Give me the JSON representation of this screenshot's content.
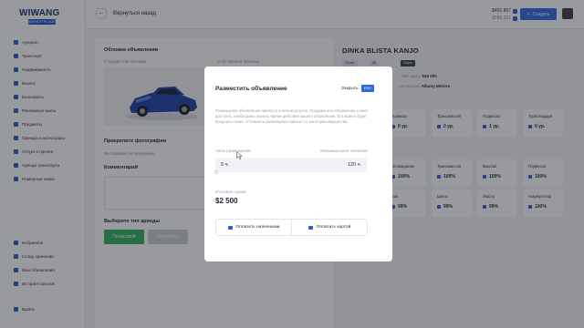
{
  "brand": {
    "name": "WIWANG",
    "sub": "MARKETPLACE"
  },
  "sidebar": {
    "items": [
      {
        "label": "Аукцион"
      },
      {
        "label": "Транспорт"
      },
      {
        "label": "Недвижимость"
      },
      {
        "label": "Бизнес"
      },
      {
        "label": "Банкоматы"
      },
      {
        "label": "Рекламные щиты"
      },
      {
        "label": "Предметы"
      },
      {
        "label": "Одежда и аксессуары"
      },
      {
        "label": "Услуги и прочее"
      },
      {
        "label": "Аренда транспорта"
      },
      {
        "label": "Номерные знаки"
      }
    ],
    "bottom_items": [
      {
        "label": "Избранное"
      },
      {
        "label": "Склад хранения"
      },
      {
        "label": "Мои объявления"
      },
      {
        "label": "История покупок"
      }
    ],
    "logout": "Выйти"
  },
  "header": {
    "back_label": "Вернуться назад",
    "balance_primary": "$401 857",
    "balance_secondary": "$586 321",
    "create_label": "Создать"
  },
  "form": {
    "cover_title": "Обложка объявления",
    "standard_cover": "Стандартная обложка",
    "own_cover": "Собственная обложка",
    "photos_title": "Прикрепите фотографии",
    "photos_hint": "Фотографии не загружены",
    "comment_title": "Комментарий",
    "rent_type_title": "Выберите тип аренды",
    "rent_hourly": "Почасовой",
    "rent_daily": "Посуточно"
  },
  "vehicle": {
    "name": "DINKA BLISTA KANJO",
    "tag_distance": "13 км.",
    "tag_number": "40",
    "tag_class": "Норм",
    "price_label": "Рег. цена:",
    "price_value": "$45 000",
    "dealer_label": "Автосалон:",
    "dealer_value": "Albany Motors",
    "specs": [
      {
        "label": "Тормоза",
        "value": "0 ур."
      },
      {
        "label": "Трансмиссия",
        "value": "0 ур."
      },
      {
        "label": "Подвеска",
        "value": "1 ур."
      },
      {
        "label": "Турбонаддув",
        "value": "0 ур."
      }
    ],
    "condition": [
      {
        "label": "Охлаждение",
        "value": "100%"
      },
      {
        "label": "Трансмиссия",
        "value": "100%"
      },
      {
        "label": "Выхлоп",
        "value": "100%"
      },
      {
        "label": "Подвеска",
        "value": "100%"
      },
      {
        "label": "Бак",
        "value": "99%"
      },
      {
        "label": "Шины",
        "value": "99%"
      },
      {
        "label": "Масло",
        "value": "99%"
      },
      {
        "label": "Аккумулятор",
        "value": "100%"
      }
    ]
  },
  "modal": {
    "title": "Разместить объявление",
    "close_label": "Закрыть",
    "esc_label": "ESC",
    "description": "Размещение объявления является платной услугой. Продажа или объявление станет доступно, необходимо указать время действия вашего объявления. Его можно будет продлить позже. Стоимость размещения зависит от категории имущества.",
    "hours_label": "Часы размещения",
    "max_label": "Максимальное значение",
    "min_value": "5 ч.",
    "max_value": "120 ч.",
    "slider_fraction": 0,
    "total_label": "Итоговая сумма",
    "total_value": "$2 500",
    "pay_cash": "Оплатить наличными",
    "pay_card": "Оплатить картой"
  },
  "colors": {
    "accent": "#2d6be4",
    "success": "#2fae5a",
    "car": "#1b3fa8"
  }
}
